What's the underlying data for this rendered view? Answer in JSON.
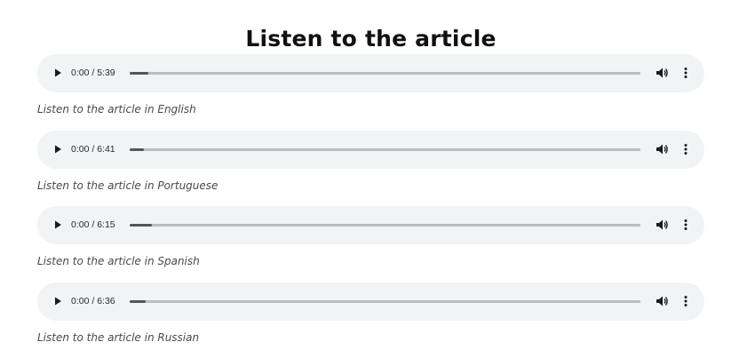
{
  "page": {
    "title": "Listen to the article"
  },
  "players": [
    {
      "time": "0:00 / 5:39",
      "progress": 0.036,
      "caption": "Listen to the article in English"
    },
    {
      "time": "0:00 / 6:41",
      "progress": 0.028,
      "caption": "Listen to the article in Portuguese"
    },
    {
      "time": "0:00 / 6:15",
      "progress": 0.043,
      "caption": "Listen to the article in Spanish"
    },
    {
      "time": "0:00 / 6:36",
      "progress": 0.031,
      "caption": "Listen to the article in Russian"
    }
  ],
  "icons": {
    "play": "play-icon",
    "volume": "volume-icon",
    "more": "more-vertical-icon"
  },
  "colors": {
    "player_background": "#f1f3f4",
    "track": "#bdbdbd",
    "track_fill": "#555555",
    "title": "#111111",
    "caption": "#4a4a4a"
  }
}
